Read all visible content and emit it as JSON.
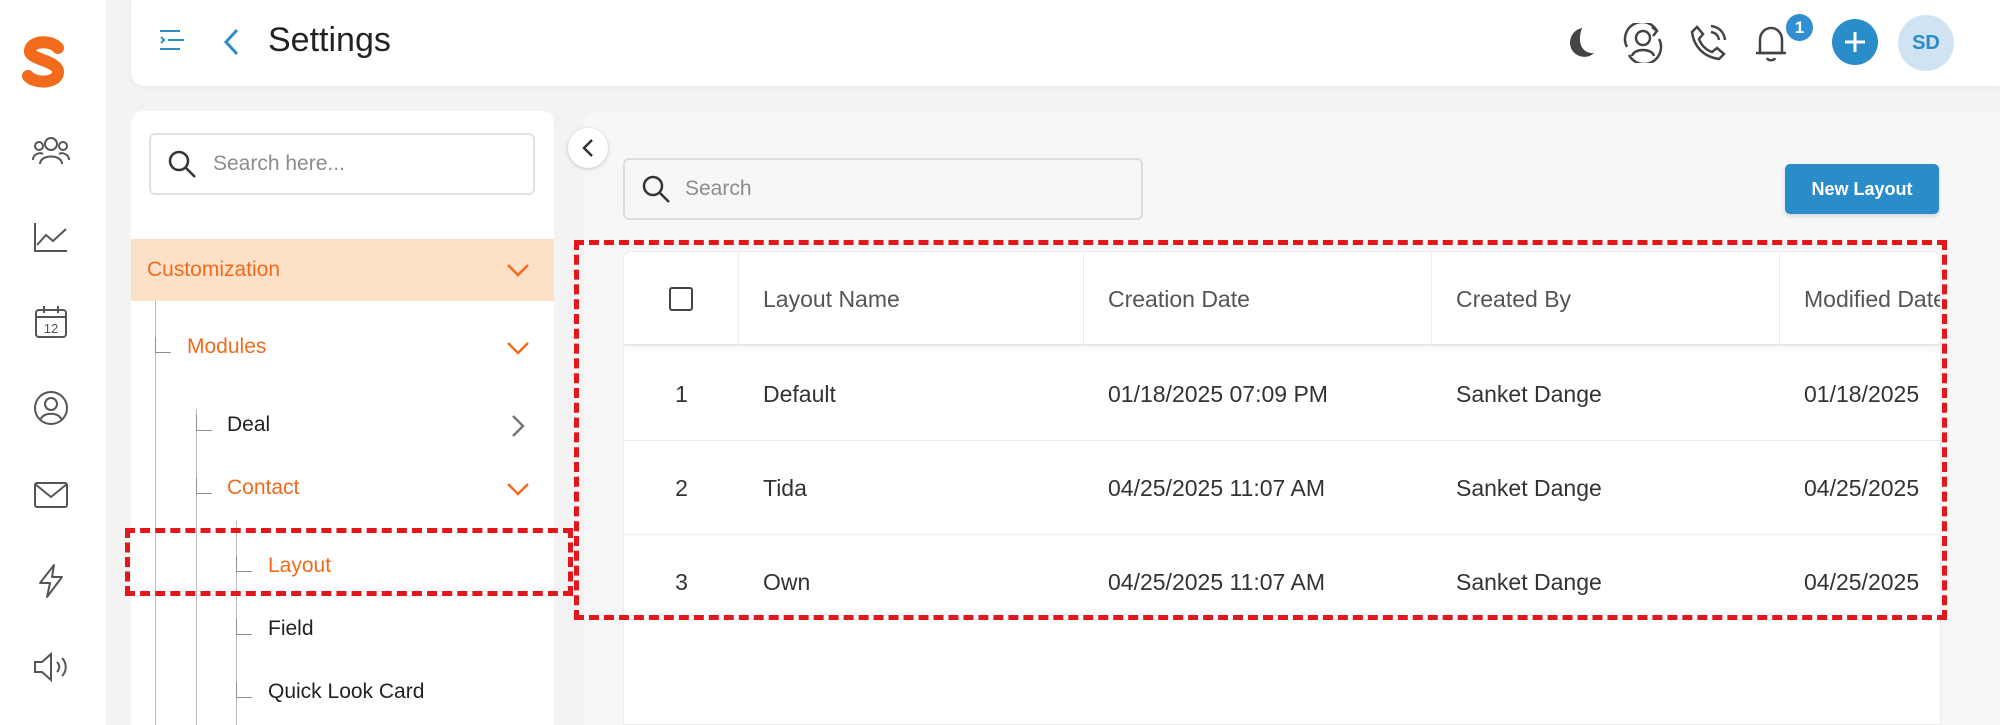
{
  "header": {
    "title": "Settings",
    "notification_count": "1",
    "avatar_initials": "SD"
  },
  "colors": {
    "accent_blue": "#2b8cca",
    "accent_orange": "#f26a1b",
    "highlight_red": "#e3161b",
    "selected_bg": "#fde0c8"
  },
  "rail_icons": [
    "logo-icon",
    "users-icon",
    "chart-icon",
    "calendar-icon",
    "contact-icon",
    "mail-icon",
    "bolt-icon",
    "speaker-icon"
  ],
  "rail": {
    "calendar_day": "12"
  },
  "settings_nav": {
    "search_placeholder": "Search here...",
    "customization": "Customization",
    "modules": "Modules",
    "deal": "Deal",
    "contact": "Contact",
    "layout": "Layout",
    "field": "Field",
    "quick_look_card": "Quick Look Card"
  },
  "main": {
    "search_placeholder": "Search",
    "new_layout_label": "New Layout",
    "columns": [
      "Layout Name",
      "Creation Date",
      "Created By",
      "Modified Date"
    ],
    "rows": [
      {
        "index": "1",
        "name": "Default",
        "created": "01/18/2025 07:09 PM",
        "by": "Sanket Dange",
        "modified": "01/18/2025"
      },
      {
        "index": "2",
        "name": "Tida",
        "created": "04/25/2025 11:07 AM",
        "by": "Sanket Dange",
        "modified": "04/25/2025"
      },
      {
        "index": "3",
        "name": "Own",
        "created": "04/25/2025 11:07 AM",
        "by": "Sanket Dange",
        "modified": "04/25/2025"
      }
    ]
  }
}
